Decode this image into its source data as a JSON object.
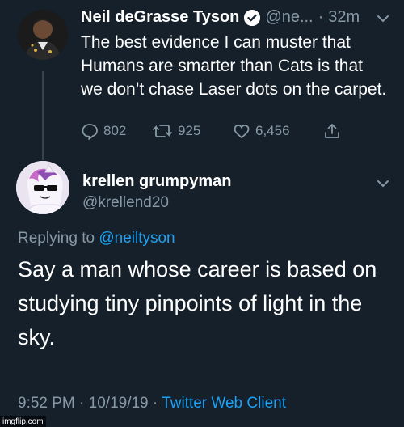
{
  "tweet1": {
    "display_name": "Neil deGrasse Tyson",
    "handle": "@ne...",
    "separator": "·",
    "time": "32m",
    "text": "The best evidence I can muster that Humans are smarter than Cats is that we don’t chase Laser dots on the carpet.",
    "replies": "802",
    "retweets": "925",
    "likes": "6,456"
  },
  "tweet2": {
    "display_name": "krellen grumpyman",
    "handle": "@krellend20",
    "replying_prefix": "Replying to",
    "replying_to": "@neiltyson",
    "text": "Say a man whose career is based on studying tiny pinpoints of light in the sky.",
    "time": "9:52 PM",
    "separator": "·",
    "date": "10/19/19",
    "separator2": "·",
    "client": "Twitter Web Client"
  },
  "watermark": "imgflip.com",
  "colors": {
    "background": "#15202b",
    "text": "#ffffff",
    "muted": "#8899a6",
    "link": "#1da1f2"
  },
  "icons": [
    "verified-badge-icon",
    "chevron-down-icon",
    "reply-icon",
    "retweet-icon",
    "like-icon",
    "share-icon"
  ]
}
